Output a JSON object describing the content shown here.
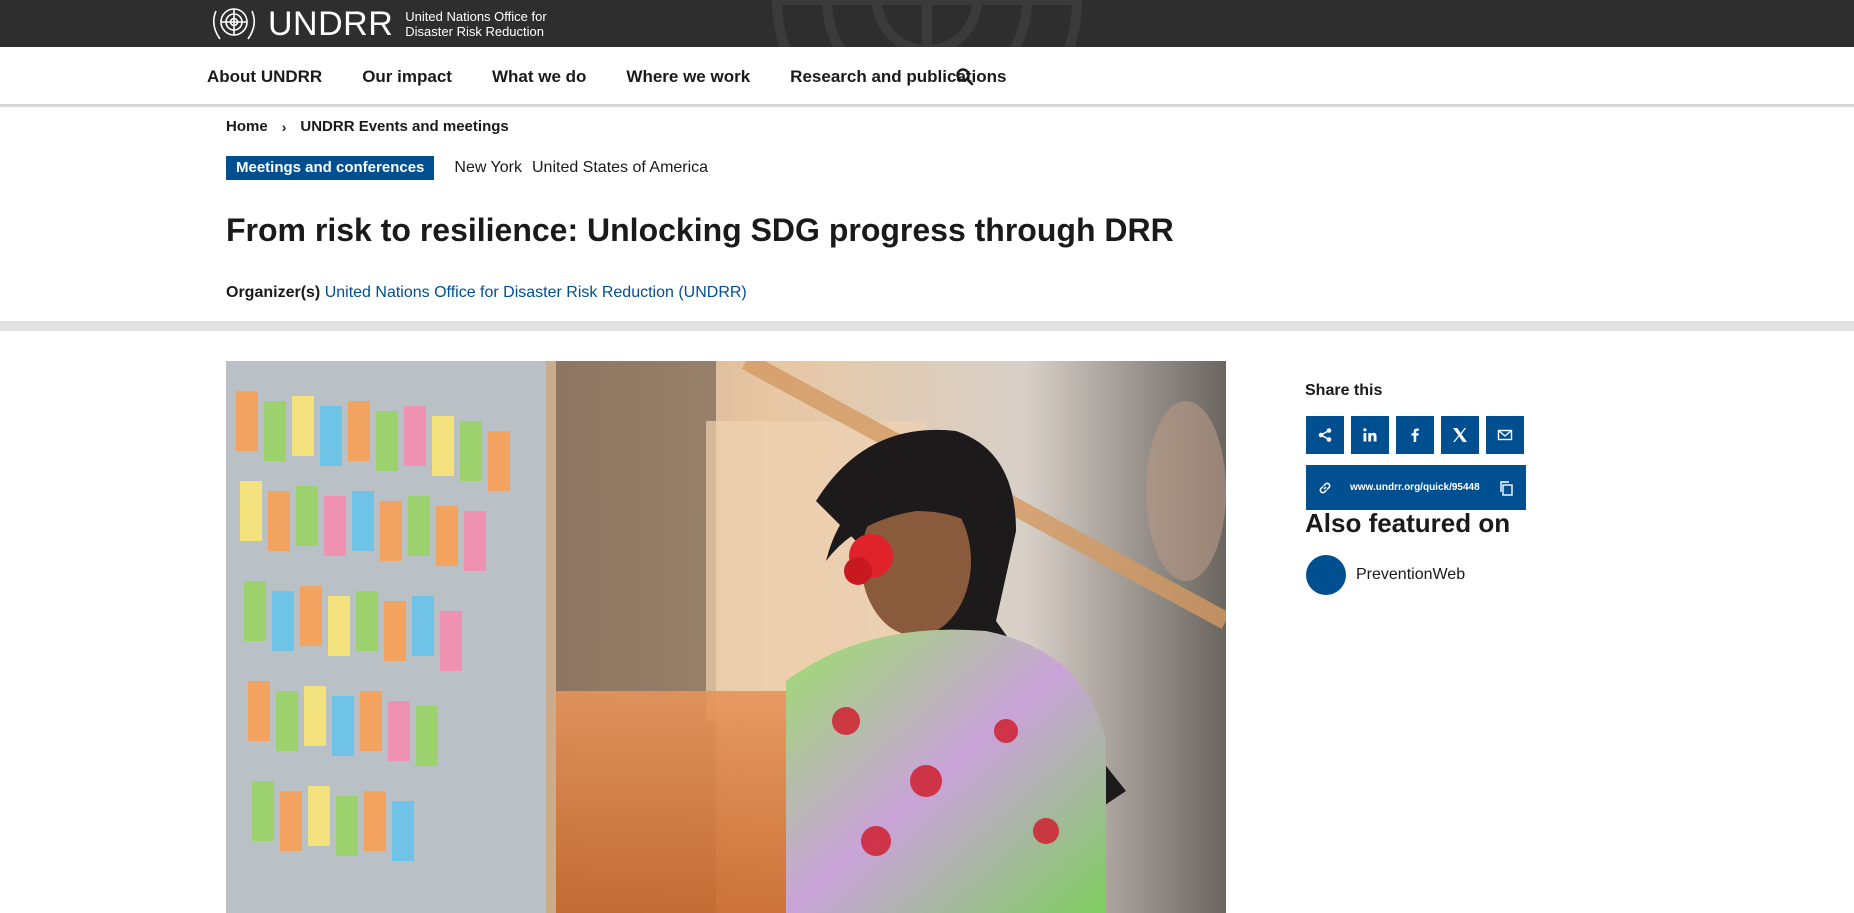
{
  "header": {
    "logo_word": "UNDRR",
    "logo_sub_line1": "United Nations Office for",
    "logo_sub_line2": "Disaster Risk Reduction"
  },
  "nav": {
    "items": [
      "About UNDRR",
      "Our impact",
      "What we do",
      "Where we work",
      "Research and publications"
    ],
    "search_icon": "search-icon"
  },
  "breadcrumb": {
    "home": "Home",
    "separator_icon": "chevron-right-icon",
    "current": "UNDRR Events and meetings"
  },
  "event": {
    "tag": "Meetings and conferences",
    "city": "New York",
    "country": "United States of America",
    "title": "From risk to resilience: Unlocking SDG progress through DRR",
    "organizer_label": "Organizer(s)",
    "organizer_name": "United Nations Office for Disaster Risk Reduction (UNDRR)"
  },
  "hero": {
    "icon": "event-photo"
  },
  "sidebar": {
    "share_title": "Share this",
    "share_buttons": [
      "share-icon",
      "linkedin-icon",
      "facebook-icon",
      "x-icon",
      "email-icon"
    ],
    "quick_link": "www.undrr.org/quick/95448",
    "featured_title": "Also featured on",
    "featured_items": [
      "PreventionWeb"
    ]
  },
  "colors": {
    "brand_blue": "#004f91",
    "topbar": "#2e2e2e",
    "divider": "#e2e2e2"
  }
}
